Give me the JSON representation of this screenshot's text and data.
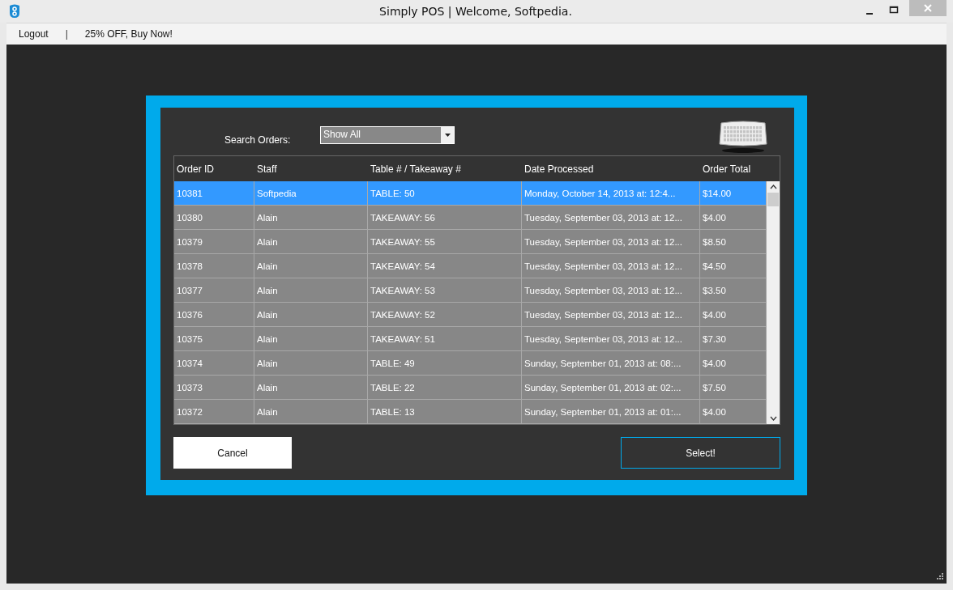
{
  "window": {
    "title": "Simply POS | Welcome, Softpedia."
  },
  "menu": [
    {
      "label": "Logout"
    },
    {
      "label": "|",
      "kind": "separator"
    },
    {
      "label": "25% OFF, Buy Now!"
    }
  ],
  "search": {
    "label": "Search Orders:",
    "value": "Show All"
  },
  "table": {
    "columns": [
      "Order ID",
      "Staff",
      "Table # / Takeaway #",
      "Date Processed",
      "Order Total"
    ],
    "rows": [
      {
        "cells": [
          "10381",
          "Softpedia",
          "TABLE: 50",
          "Monday, October 14, 2013 at: 12:4...",
          "$14.00"
        ],
        "selected": true
      },
      {
        "cells": [
          "10380",
          "Alain",
          "TAKEAWAY: 56",
          "Tuesday, September 03, 2013 at: 12...",
          "$4.00"
        ],
        "selected": false
      },
      {
        "cells": [
          "10379",
          "Alain",
          "TAKEAWAY: 55",
          "Tuesday, September 03, 2013 at: 12...",
          "$8.50"
        ],
        "selected": false
      },
      {
        "cells": [
          "10378",
          "Alain",
          "TAKEAWAY: 54",
          "Tuesday, September 03, 2013 at: 12...",
          "$4.50"
        ],
        "selected": false
      },
      {
        "cells": [
          "10377",
          "Alain",
          "TAKEAWAY: 53",
          "Tuesday, September 03, 2013 at: 12...",
          "$3.50"
        ],
        "selected": false
      },
      {
        "cells": [
          "10376",
          "Alain",
          "TAKEAWAY: 52",
          "Tuesday, September 03, 2013 at: 12...",
          "$4.00"
        ],
        "selected": false
      },
      {
        "cells": [
          "10375",
          "Alain",
          "TAKEAWAY: 51",
          "Tuesday, September 03, 2013 at: 12...",
          "$7.30"
        ],
        "selected": false
      },
      {
        "cells": [
          "10374",
          "Alain",
          "TABLE: 49",
          "Sunday, September 01, 2013 at: 08:...",
          "$4.00"
        ],
        "selected": false
      },
      {
        "cells": [
          "10373",
          "Alain",
          "TABLE: 22",
          "Sunday, September 01, 2013 at: 02:...",
          "$7.50"
        ],
        "selected": false
      },
      {
        "cells": [
          "10372",
          "Alain",
          "TABLE: 13",
          "Sunday, September 01, 2013 at: 01:...",
          "$4.00"
        ],
        "selected": false
      }
    ]
  },
  "buttons": [
    {
      "label": "Cancel",
      "kind": "secondary"
    },
    {
      "label": "Select!",
      "kind": "primary"
    }
  ]
}
